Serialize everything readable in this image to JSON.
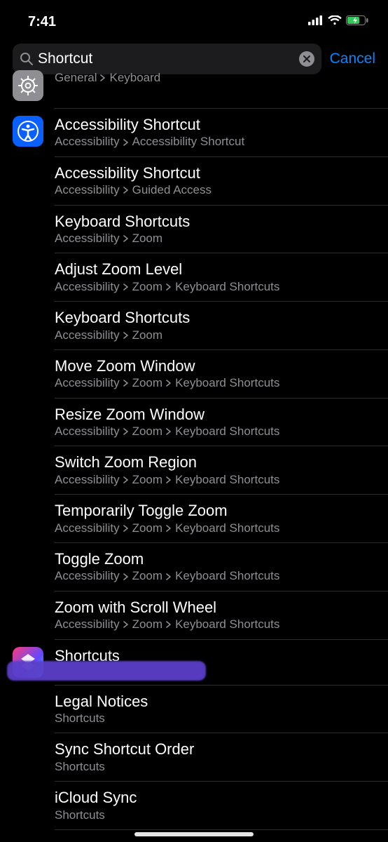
{
  "status": {
    "time": "7:41"
  },
  "search": {
    "value": "Shortcut",
    "cancel": "Cancel"
  },
  "rows": [
    {
      "icon": "gear",
      "title": "",
      "path": [
        "General",
        "Keyboard"
      ],
      "partial_top": true
    },
    {
      "icon": "access",
      "title": "Accessibility Shortcut",
      "path": [
        "Accessibility",
        "Accessibility Shortcut"
      ]
    },
    {
      "icon": "",
      "title": "Accessibility Shortcut",
      "path": [
        "Accessibility",
        "Guided Access"
      ]
    },
    {
      "icon": "",
      "title": "Keyboard Shortcuts",
      "path": [
        "Accessibility",
        "Zoom"
      ]
    },
    {
      "icon": "",
      "title": "Adjust Zoom Level",
      "path": [
        "Accessibility",
        "Zoom",
        "Keyboard Shortcuts"
      ]
    },
    {
      "icon": "",
      "title": "Keyboard Shortcuts",
      "path": [
        "Accessibility",
        "Zoom"
      ]
    },
    {
      "icon": "",
      "title": "Move Zoom Window",
      "path": [
        "Accessibility",
        "Zoom",
        "Keyboard Shortcuts"
      ]
    },
    {
      "icon": "",
      "title": "Resize Zoom Window",
      "path": [
        "Accessibility",
        "Zoom",
        "Keyboard Shortcuts"
      ]
    },
    {
      "icon": "",
      "title": "Switch Zoom Region",
      "path": [
        "Accessibility",
        "Zoom",
        "Keyboard Shortcuts"
      ]
    },
    {
      "icon": "",
      "title": "Temporarily Toggle Zoom",
      "path": [
        "Accessibility",
        "Zoom",
        "Keyboard Shortcuts"
      ]
    },
    {
      "icon": "",
      "title": "Toggle Zoom",
      "path": [
        "Accessibility",
        "Zoom",
        "Keyboard Shortcuts"
      ]
    },
    {
      "icon": "",
      "title": "Zoom with Scroll Wheel",
      "path": [
        "Accessibility",
        "Zoom",
        "Keyboard Shortcuts"
      ]
    },
    {
      "icon": "shortcuts",
      "title": "Shortcuts",
      "path": []
    },
    {
      "icon": "",
      "title": "Legal Notices",
      "path": [
        "Shortcuts"
      ]
    },
    {
      "icon": "",
      "title": "Sync Shortcut Order",
      "path": [
        "Shortcuts"
      ]
    },
    {
      "icon": "",
      "title": "iCloud Sync",
      "path": [
        "Shortcuts"
      ]
    }
  ]
}
